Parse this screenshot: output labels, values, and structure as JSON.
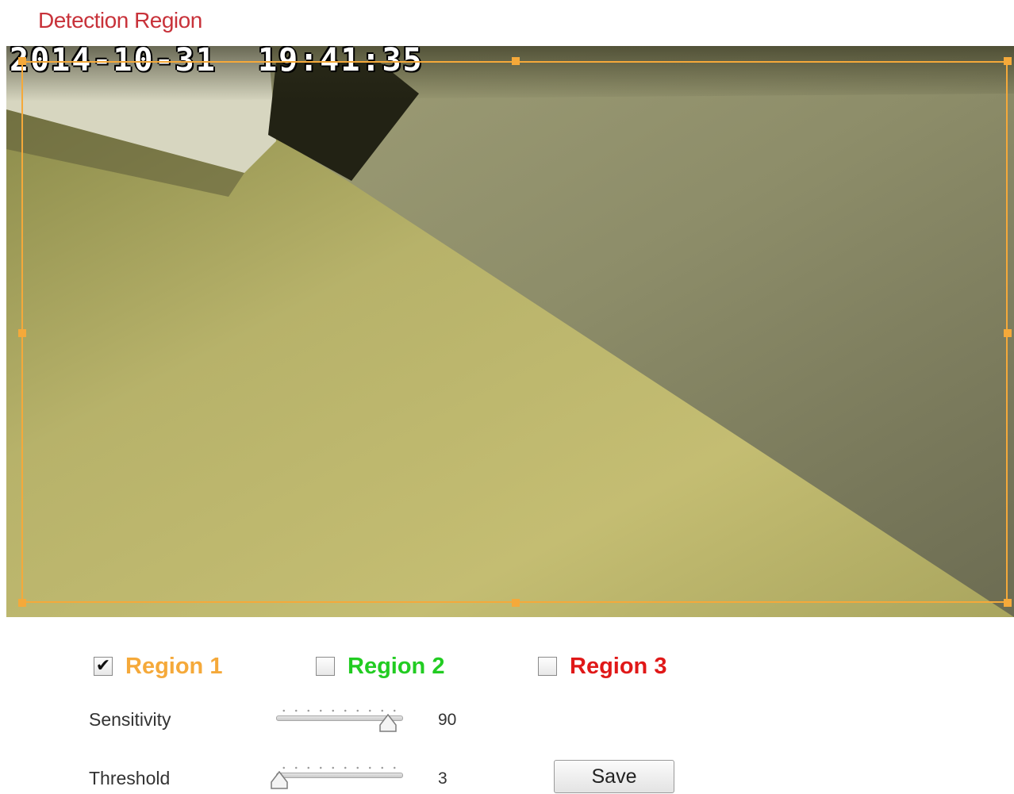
{
  "section_title": "Detection Region",
  "video": {
    "timestamp": "2014-10-31  19:41:35",
    "region_box_color": "#f5a93a"
  },
  "regions": [
    {
      "label": "Region 1",
      "checked": true,
      "check_glyph": "✔",
      "color": "#f5a93a"
    },
    {
      "label": "Region 2",
      "checked": false,
      "check_glyph": "",
      "color": "#22cc22"
    },
    {
      "label": "Region 3",
      "checked": false,
      "check_glyph": "",
      "color": "#e01818"
    }
  ],
  "sensitivity": {
    "label": "Sensitivity",
    "value": "90",
    "level": 0.9
  },
  "threshold": {
    "label": "Threshold",
    "value": "3",
    "level": 0.0
  },
  "save_label": "Save"
}
